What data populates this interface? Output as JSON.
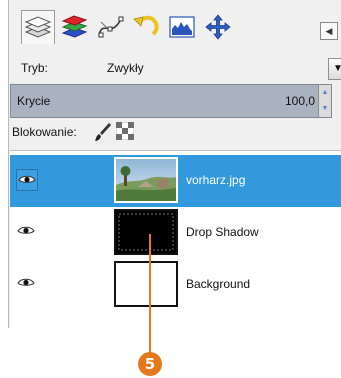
{
  "toolbar": {
    "tabs": [
      {
        "name": "layers-tab",
        "icon": "layers-icon",
        "active": true
      },
      {
        "name": "channels-tab",
        "icon": "channels-icon",
        "active": false
      },
      {
        "name": "paths-tab",
        "icon": "paths-icon",
        "active": false
      },
      {
        "name": "undo-history-tab",
        "icon": "undo-history-icon",
        "active": false
      },
      {
        "name": "histogram-tab",
        "icon": "histogram-icon",
        "active": false
      },
      {
        "name": "navigation-tab",
        "icon": "move-icon",
        "active": false
      }
    ],
    "menu_icon": "◀"
  },
  "mode": {
    "label": "Tryb:",
    "value": "Zwykły",
    "dropdown_arrow": "▼"
  },
  "opacity": {
    "label": "Krycie",
    "value": "100,0",
    "up_arrow": "▲",
    "down_arrow": "▼"
  },
  "lock": {
    "label": "Blokowanie:",
    "brush_icon": "brush-icon",
    "alpha_icon": "checkerboard-icon"
  },
  "layers": [
    {
      "name": "vorharz.jpg",
      "selected": true,
      "visible": true,
      "thumbnail": "photo"
    },
    {
      "name": "Drop Shadow",
      "selected": false,
      "visible": true,
      "thumbnail": "shadow"
    },
    {
      "name": "Background",
      "selected": false,
      "visible": true,
      "thumbnail": "blank"
    }
  ],
  "callout": {
    "number": "5",
    "color": "#e5781a"
  },
  "colors": {
    "selection": "#3399dd",
    "opacity_bar": "#a9b3bf",
    "panel": "#f0f0f0"
  }
}
